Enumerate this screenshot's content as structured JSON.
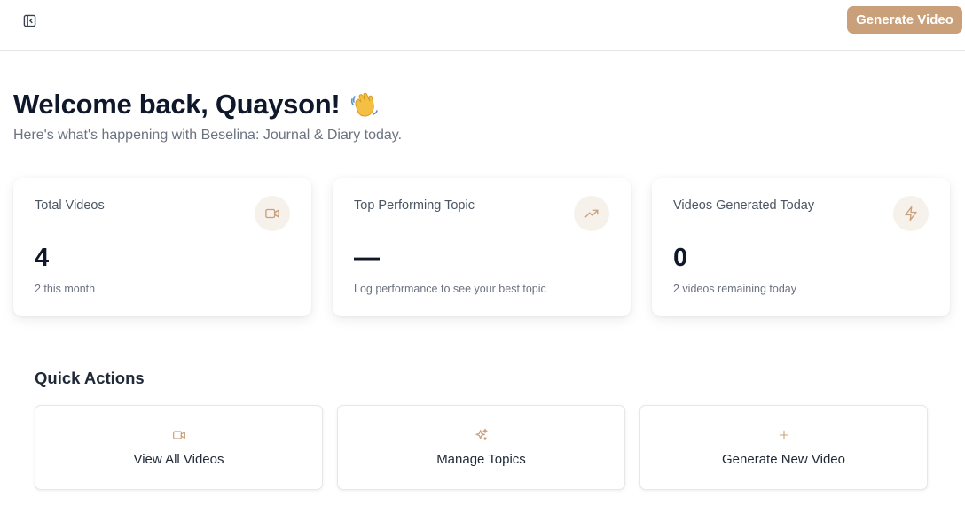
{
  "header": {
    "sidebar_toggle_icon": "panel-left-close-icon",
    "generate_button_label": "Generate Video",
    "accent_color": "#c9a07a"
  },
  "welcome": {
    "title": "Welcome back, Quayson!",
    "emoji_icon": "waving-hand-icon",
    "subtitle": "Here's what's happening with Beselina: Journal & Diary today."
  },
  "stats": [
    {
      "label": "Total Videos",
      "value": "4",
      "caption": "2 this month",
      "icon": "video-icon"
    },
    {
      "label": "Top Performing Topic",
      "value": "—",
      "caption": "Log performance to see your best topic",
      "icon": "trending-up-icon"
    },
    {
      "label": "Videos Generated Today",
      "value": "0",
      "caption": "2 videos remaining today",
      "icon": "lightning-icon"
    }
  ],
  "quick_actions": {
    "title": "Quick Actions",
    "items": [
      {
        "label": "View All Videos",
        "icon": "video-icon"
      },
      {
        "label": "Manage Topics",
        "icon": "sparkles-icon"
      },
      {
        "label": "Generate New Video",
        "icon": "plus-icon"
      }
    ]
  }
}
